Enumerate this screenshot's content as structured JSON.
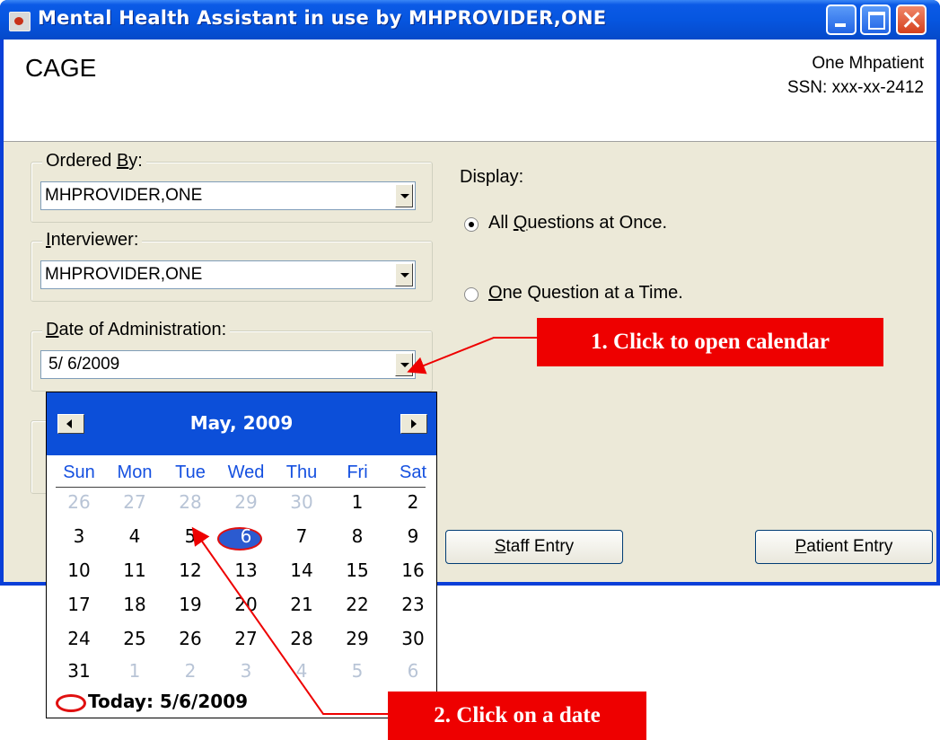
{
  "window": {
    "title": "Mental Health Assistant in use by MHPROVIDER,ONE",
    "controls": [
      "minimize",
      "maximize",
      "close"
    ]
  },
  "header": {
    "form_title": "CAGE",
    "patient_name": "One Mhpatient",
    "patient_ssn": "SSN: xxx-xx-2412"
  },
  "ordered_by": {
    "label_pre": "Ordered ",
    "label_key": "B",
    "label_post": "y:",
    "value": "MHPROVIDER,ONE"
  },
  "interviewer": {
    "label_key": "I",
    "label_post": "nterviewer:",
    "value": "MHPROVIDER,ONE"
  },
  "date_admin": {
    "label_key": "D",
    "label_post": "ate of Administration:",
    "value": "5/ 6/2009"
  },
  "display": {
    "label": "Display:",
    "option_all": {
      "pre": "All ",
      "key": "Q",
      "post": "uestions at Once.",
      "selected": true
    },
    "option_one": {
      "key": "O",
      "post": "ne Question at a Time.",
      "selected": false
    }
  },
  "buttons": {
    "staff_key": "S",
    "staff_post": "taff Entry",
    "patient_key": "P",
    "patient_post": "atient Entry"
  },
  "calendar": {
    "month_label": "May, 2009",
    "days_of_week": [
      "Sun",
      "Mon",
      "Tue",
      "Wed",
      "Thu",
      "Fri",
      "Sat"
    ],
    "weeks": [
      [
        "26",
        "27",
        "28",
        "29",
        "30",
        "1",
        "2"
      ],
      [
        "3",
        "4",
        "5",
        "6",
        "7",
        "8",
        "9"
      ],
      [
        "10",
        "11",
        "12",
        "13",
        "14",
        "15",
        "16"
      ],
      [
        "17",
        "18",
        "19",
        "20",
        "21",
        "22",
        "23"
      ],
      [
        "24",
        "25",
        "26",
        "27",
        "28",
        "29",
        "30"
      ],
      [
        "31",
        "1",
        "2",
        "3",
        "4",
        "5",
        "6"
      ]
    ],
    "selected_day": "6",
    "today_label": "Today: 5/6/2009"
  },
  "annotations": {
    "step1": "1. Click to open calendar",
    "step2": "2. Click on a date"
  },
  "colors": {
    "titlebar": "#0656e0",
    "panel": "#ece9d8",
    "calendar_header": "#0c4fd9",
    "callout": "#ee0000"
  }
}
